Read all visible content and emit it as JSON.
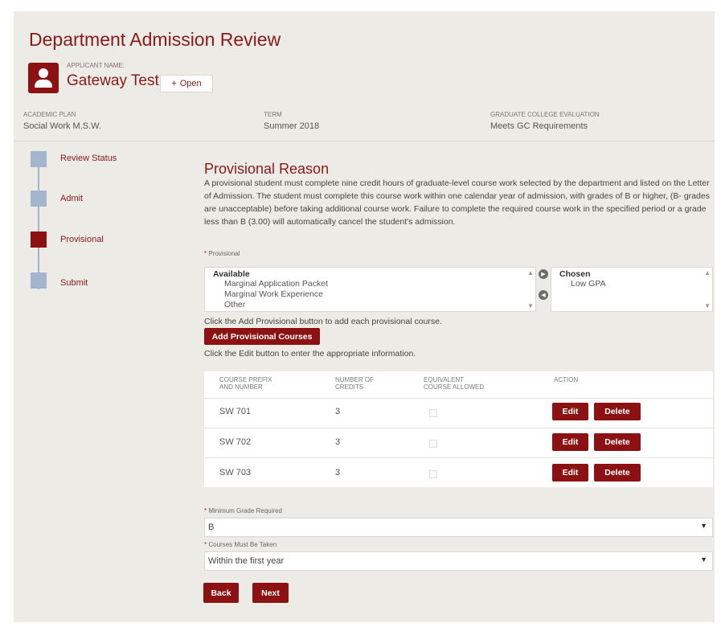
{
  "header": {
    "title": "Department Admission Review",
    "applicant_label": "APPLICANT NAME:",
    "applicant_name": "Gateway Test",
    "open_button": "Open",
    "open_icon": "+"
  },
  "meta": [
    {
      "label": "ACADEMIC PLAN",
      "value": "Social Work M.S.W."
    },
    {
      "label": "TERM",
      "value": "Summer 2018"
    },
    {
      "label": "GRADUATE COLLEGE EVALUATION",
      "value": "Meets GC Requirements"
    }
  ],
  "steps": [
    {
      "label": "Review Status",
      "active": false
    },
    {
      "label": "Admit",
      "active": false
    },
    {
      "label": "Provisional",
      "active": true
    },
    {
      "label": "Submit",
      "active": false
    }
  ],
  "content": {
    "title": "Provisional Reason",
    "description": "A provisional student must complete nine credit hours of graduate-level course work selected by the department and listed on the Letter of Admission. The student must complete this course work within one calendar year of admission, with grades of B or higher, (B- grades are unacceptable) before taking additional course work. Failure to complete the required course work in the specified period or a grade less than B (3.00) will automatically cancel the student's admission.",
    "provisional_label": "Provisional",
    "required_mark": "*",
    "available_heading": "Available",
    "available_items": [
      "Marginal Application Packet",
      "Marginal Work Experience",
      "Other"
    ],
    "chosen_heading": "Chosen",
    "chosen_items": [
      "Low GPA"
    ],
    "add_instruction": "Click the Add Provisional button to add each provisional course.",
    "add_button": "Add Provisional Courses",
    "edit_instruction": "Click the Edit button to enter the appropriate information."
  },
  "table": {
    "headers": [
      [
        "COURSE PREFIX",
        "AND NUMBER"
      ],
      [
        "NUMBER OF",
        "CREDITS"
      ],
      [
        "EQUIVALENT",
        "COURSE ALLOWED"
      ],
      [
        "ACTION",
        ""
      ]
    ],
    "rows": [
      {
        "course": "SW 701",
        "credits": "3",
        "equivalent": false
      },
      {
        "course": "SW 702",
        "credits": "3",
        "equivalent": false
      },
      {
        "course": "SW 703",
        "credits": "3",
        "equivalent": false
      }
    ],
    "edit_label": "Edit",
    "delete_label": "Delete"
  },
  "form": {
    "min_grade_label": "Minimum Grade Required",
    "min_grade_value": "B",
    "courses_taken_label": "Courses Must Be Taken",
    "courses_taken_value": "Within the first year"
  },
  "footer": {
    "back_button": "Back",
    "next_button": "Next"
  },
  "colors": {
    "accent": "#8b1113",
    "step_inactive": "#a3b6cc",
    "background": "#ecebe6"
  }
}
